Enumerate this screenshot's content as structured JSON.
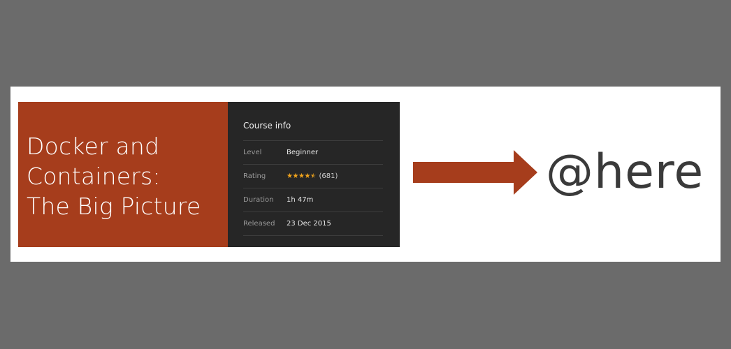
{
  "course": {
    "title_lines": [
      "Docker and",
      "Containers:",
      "The Big Picture"
    ],
    "info_heading": "Course info",
    "level": {
      "label": "Level",
      "value": "Beginner"
    },
    "rating": {
      "label": "Rating",
      "stars": 4.5,
      "count": "(681)"
    },
    "duration": {
      "label": "Duration",
      "value": "1h 47m"
    },
    "released": {
      "label": "Released",
      "value": "23 Dec 2015"
    }
  },
  "mention": {
    "text": "@here"
  },
  "colors": {
    "background": "#6b6b6b",
    "slide": "#ffffff",
    "accent": "#a63d1c",
    "info_panel": "#262626",
    "star": "#f0a31c",
    "mention_text": "#3a3a3a"
  },
  "icons": {
    "arrow": "arrow-right-icon",
    "star": "star-icon"
  }
}
